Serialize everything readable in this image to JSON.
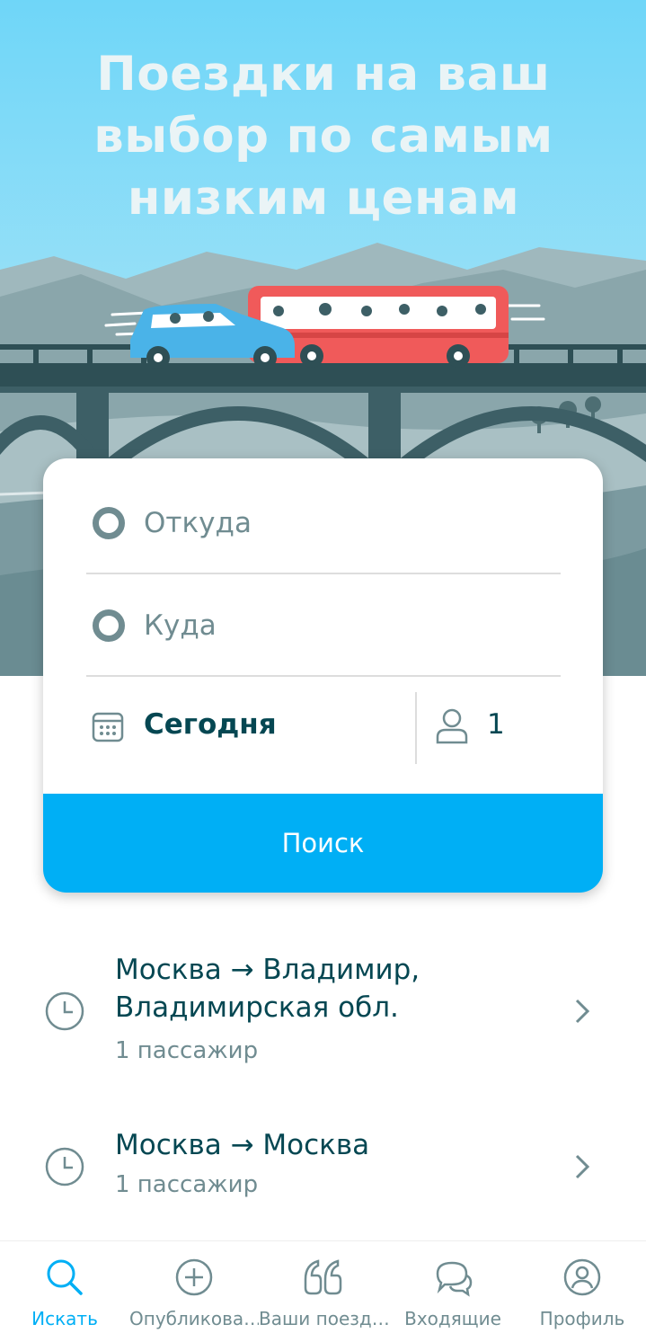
{
  "hero": {
    "title_line1": "Поездки на ваш",
    "title_line2": "выбор по самым",
    "title_line3": "низким ценам"
  },
  "search_form": {
    "from_label": "Откуда",
    "to_label": "Куда",
    "date_label": "Сегодня",
    "passengers": "1",
    "search_button": "Поиск"
  },
  "recent_searches": [
    {
      "route_line1": "Москва → Владимир,",
      "route_line2": "Владимирская обл.",
      "passengers": "1 пассажир"
    },
    {
      "route_line1": "Москва → Москва",
      "route_line2": "",
      "passengers": "1 пассажир"
    }
  ],
  "tab_bar": {
    "items": [
      {
        "label": "Искать",
        "icon": "search-icon",
        "active": true
      },
      {
        "label": "Опубликова…",
        "icon": "plus-circle-icon",
        "active": false
      },
      {
        "label": "Ваши поезд…",
        "icon": "quote-icon",
        "active": false
      },
      {
        "label": "Входящие",
        "icon": "chat-icon",
        "active": false
      },
      {
        "label": "Профиль",
        "icon": "profile-icon",
        "active": false
      }
    ]
  },
  "colors": {
    "brand_blue": "#00aff5",
    "text_dark": "#054752",
    "text_muted": "#708c91",
    "bus_red": "#f05a5a",
    "car_blue": "#4ab3e8"
  }
}
